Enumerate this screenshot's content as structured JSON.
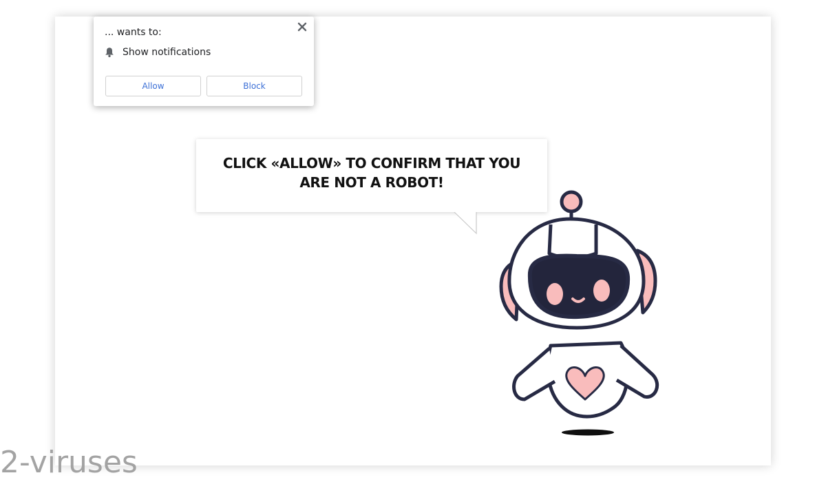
{
  "permission_prompt": {
    "origin_text": "... wants to:",
    "permission_label": "Show notifications",
    "allow_label": "Allow",
    "block_label": "Block",
    "icons": {
      "permission": "bell-icon",
      "close": "close-icon"
    }
  },
  "page": {
    "headline_line1": "CLICK «ALLOW» TO CONFIRM THAT YOU",
    "headline_line2": "ARE NOT A ROBOT!",
    "illustration": "robot-illustration"
  },
  "watermark": {
    "text": "2-viruses"
  },
  "colors": {
    "button_text": "#3b6fd6",
    "robot_outline": "#272a44",
    "robot_visor": "#23253c",
    "robot_accent": "#f9bcbc",
    "robot_shadow": "#0f0f0f"
  }
}
